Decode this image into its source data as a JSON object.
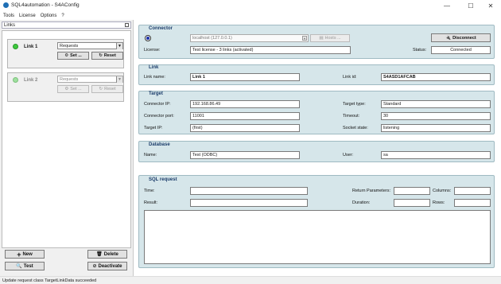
{
  "window": {
    "title": "SQL4automation - S4AConfig",
    "minimize": "—",
    "maximize": "☐",
    "close": "✕"
  },
  "menu": [
    "Tools",
    "License",
    "Options",
    "?"
  ],
  "links_panel": {
    "header": "Links",
    "links": [
      {
        "label": "Link 1",
        "active": true,
        "request_value": "Requests",
        "set_label": "Set ...",
        "reset_label": "Reset"
      },
      {
        "label": "Link 2",
        "active": false,
        "request_value": "Requests",
        "set_label": "Set ...",
        "reset_label": "Reset"
      }
    ],
    "buttons": {
      "new": "New",
      "delete": "Delete",
      "test": "Test",
      "deactivate": "Deactivate"
    }
  },
  "connector": {
    "title": "Connector",
    "server": "localhost (127.0.0.1)",
    "hosts_label": "Hosts ...",
    "disconnect_label": "Disconnect",
    "license_label": "License:",
    "license_value": "Test license - 3 links (activated)",
    "status_label": "Status:",
    "status_value": "Connected"
  },
  "link": {
    "title": "Link",
    "name_label": "Link name:",
    "name_value": "Link 1",
    "id_label": "Link id:",
    "id_value": "S4ASD1AFCAB"
  },
  "target": {
    "title": "Target",
    "ip_label": "Connector IP:",
    "ip_value": "192.168.86.49",
    "port_label": "Connector port:",
    "port_value": "11001",
    "target_ip_label": "Target IP:",
    "target_ip_value": "(first)",
    "type_label": "Target type:",
    "type_value": "Standard",
    "timeout_label": "Timeout:",
    "timeout_value": "30",
    "socket_label": "Socket state:",
    "socket_value": "listening"
  },
  "database": {
    "title": "Database",
    "name_label": "Name:",
    "name_value": "Test (ODBC)",
    "user_label": "User:",
    "user_value": "sa"
  },
  "sql_request": {
    "title": "SQL request",
    "time_label": "Time:",
    "result_label": "Result:",
    "return_params_label": "Return Parameters:",
    "columns_label": "Columns:",
    "duration_label": "Duration:",
    "rows_label": "Rows:"
  },
  "status_bar": "Update request class TargetLinkData succeeded"
}
